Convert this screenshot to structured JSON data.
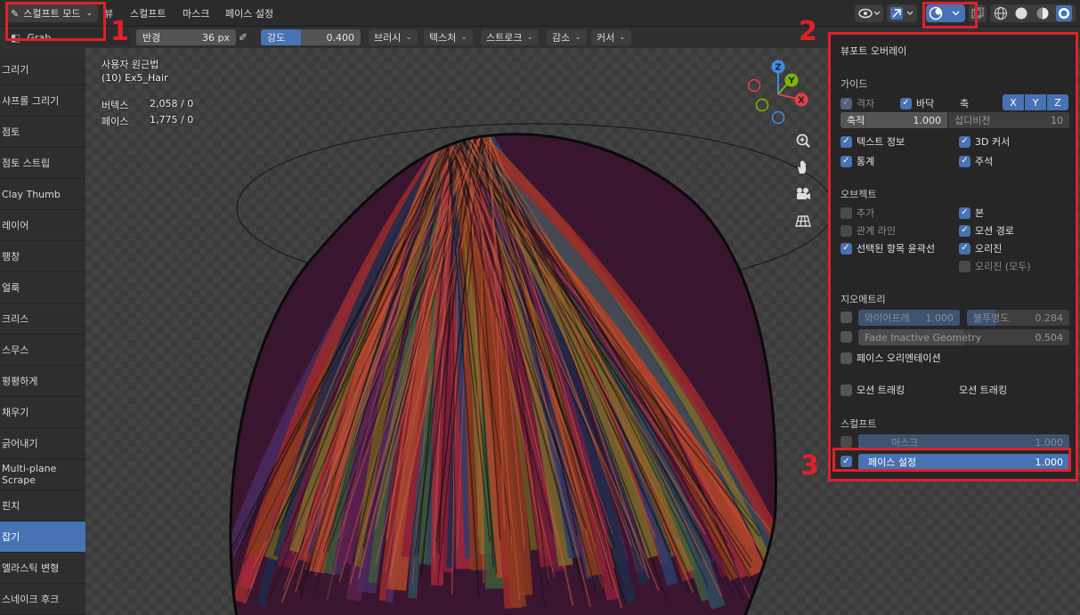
{
  "header": {
    "mode_label": "스컬프트 모드",
    "menus": [
      "뷰",
      "스컬프트",
      "마스크",
      "페이스 설정"
    ]
  },
  "toolbar": {
    "brush_name": "Grab",
    "radius": {
      "label": "반경",
      "value": "36 px"
    },
    "strength": {
      "label": "강도",
      "value": "0.400",
      "fraction": 0.4
    },
    "dropdowns": [
      "브러시",
      "텍스처",
      "스트로크",
      "감소",
      "커서"
    ]
  },
  "tools": [
    "그리기",
    "샤프롤 그리기",
    "점토",
    "점토 스트립",
    "Clay Thumb",
    "레이어",
    "팽창",
    "얼룩",
    "크리스",
    "스무스",
    "평평하게",
    "채우기",
    "긁어내기",
    "Multi-plane Scrape",
    "핀치",
    "잡기",
    "엘라스틱 변형",
    "스네이크 후크"
  ],
  "active_tool_index": 15,
  "viewport": {
    "method": "사용자 원근법",
    "object": "(10) Ex5_Hair",
    "stats": [
      {
        "label": "버텍스",
        "value": "2,058 / 0"
      },
      {
        "label": "페이스",
        "value": "1,775 / 0"
      }
    ],
    "gizmo_axes": [
      "X",
      "Y",
      "Z"
    ]
  },
  "overlay": {
    "title": "뷰포트 오버레이",
    "guides": {
      "heading": "가이드",
      "grid": "격자",
      "floor": "바닥",
      "axis": "축",
      "axes": [
        "X",
        "Y",
        "Z"
      ],
      "scale": {
        "label": "축적",
        "value": "1.000"
      },
      "subdiv": {
        "label": "섭디비전",
        "value": "10"
      },
      "text_info": "텍스트 정보",
      "cursor3d": "3D 커서",
      "stats": "통계",
      "annotations": "주석"
    },
    "objects": {
      "heading": "오브젝트",
      "extras": "추가",
      "bones": "본",
      "relationship_lines": "관계 라인",
      "motion_paths": "모션 경로",
      "outline_selected": "선택된 항목 윤곽선",
      "origins": "오리진",
      "origins_all": "오리진 (모두)"
    },
    "geometry": {
      "heading": "지오메트리",
      "wireframe": {
        "label": "와이어프레",
        "value": "1.000"
      },
      "opacity": {
        "label": "불투명도",
        "value": "0.284",
        "fraction": 0.284
      },
      "fade_inactive": {
        "label": "Fade Inactive Geometry",
        "value": "0.504"
      },
      "face_orientation": "페이스 오리엔테이션"
    },
    "motion_tracking": {
      "checkbox": "모션 트래킹",
      "label": "모션 트래킹"
    },
    "sculpt": {
      "heading": "스컬프트",
      "mask": {
        "label": "마스크",
        "value": "1.000"
      },
      "face_sets": {
        "label": "페이스 설정",
        "value": "1.000"
      }
    }
  },
  "annotations": [
    "1",
    "2",
    "3"
  ],
  "colors": {
    "accent": "#4772b3",
    "highlight_red": "#e0202a"
  }
}
